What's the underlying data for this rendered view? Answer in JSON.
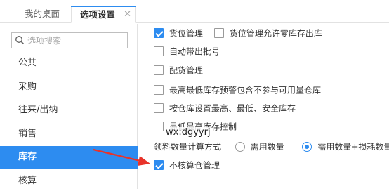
{
  "tabs": {
    "home": "我的桌面",
    "options": "选项设置",
    "close": "✕"
  },
  "search": {
    "placeholder": "选项搜索",
    "icon": "search-icon"
  },
  "sidebar": {
    "items": [
      {
        "label": "公共"
      },
      {
        "label": "采购"
      },
      {
        "label": "往来/出纳"
      },
      {
        "label": "销售"
      },
      {
        "label": "库存",
        "active": true
      },
      {
        "label": "核算"
      }
    ]
  },
  "options": {
    "location_mgmt": "货位管理",
    "location_zero_stock": "货位管理允许零库存出库",
    "auto_batch": "自动带出批号",
    "allocation_mgmt": "配货管理",
    "max_min_warning": "最高最低库存预警包含不参与可用量仓库",
    "by_warehouse_limits": "按仓库设置最高、最低、安全库存",
    "min_max_control": "最低最高库存控制",
    "qty_calc_label": "领料数量计算方式",
    "qty_option_a": "需用数量",
    "qty_option_b": "需用数量+损耗数量",
    "no_accounting_warehouse": "不核算仓管理"
  },
  "watermark": "wx:dgyyrj",
  "colors": {
    "accent": "#2d8cf0",
    "arrow": "#e8332a"
  }
}
